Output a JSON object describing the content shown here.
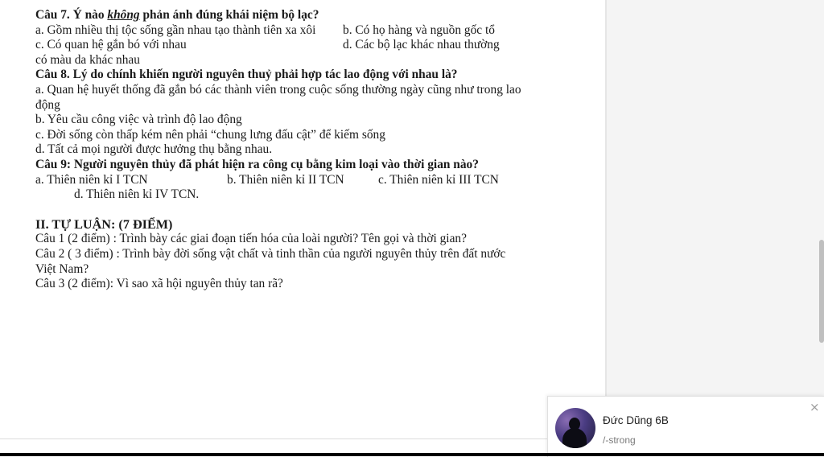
{
  "document": {
    "q7": {
      "title_prefix": "Câu 7. Ý nào ",
      "title_emph": "không",
      "title_suffix": " phản ánh đúng khái niệm bộ lạc?",
      "a": "a. Gồm nhiều thị tộc sống gần nhau tạo thành tiên xa xôi",
      "b": "b. Có họ hàng và nguồn gốc tổ",
      "c": "c. Có quan hệ gắn bó với nhau",
      "d": "d. Các bộ lạc khác nhau thường",
      "d_cont": "có màu da khác nhau"
    },
    "q8": {
      "title": "Câu 8. Lý do chính khiến người nguyên thuỷ phải hợp tác lao động với nhau là?",
      "a": "a. Quan hệ huyết thống đã gắn bó các thành viên trong cuộc sống thường ngày cũng như trong lao động",
      "b": "b. Yêu cầu công việc và trình độ lao động",
      "c": "c. Đời sống còn thấp kém nên phải “chung lưng đấu cật” để kiếm sống",
      "d": "d. Tất cả mọi người được hưởng thụ bằng nhau."
    },
    "q9": {
      "title": "Câu 9: Người nguyên thủy đã phát hiện ra công cụ bằng kim loại vào thời gian nào?",
      "a": "a. Thiên niên kỉ I TCN",
      "b": "b. Thiên niên kỉ II TCN",
      "c": "c. Thiên niên kỉ III TCN",
      "d": "d. Thiên niên kỉ IV TCN."
    },
    "essay": {
      "heading": "II. TỰ LUẬN: (7 ĐIỂM)",
      "q1": "Câu 1 (2 điểm) : Trình bày các giai đoạn tiến hóa của loài người? Tên gọi và thời gian?",
      "q2": "Câu 2 ( 3 điểm) : Trình bày đời sống vật chất và tinh thần của người nguyên thủy trên đất nước Việt Nam?",
      "q3": "Câu 3 (2 điểm): Vì sao xã hội nguyên thủy tan rã?"
    }
  },
  "user_card": {
    "name": "Đức Dũng 6B",
    "subtitle": "/-strong",
    "close_icon": "close-icon",
    "close_glyph": "×"
  }
}
